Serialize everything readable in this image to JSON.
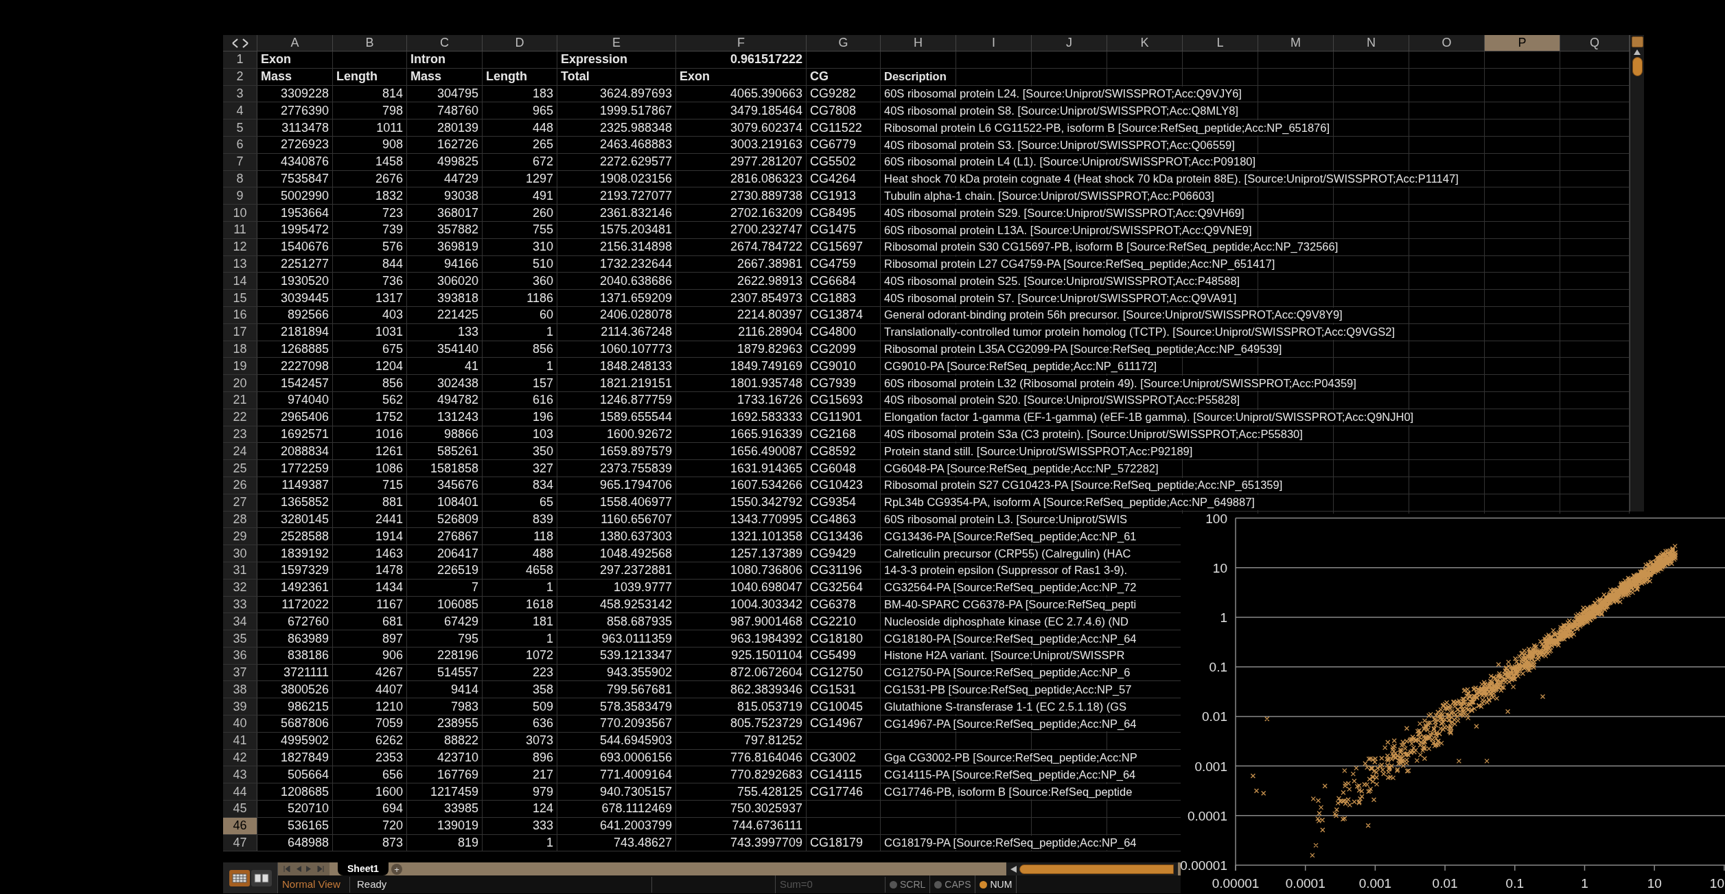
{
  "columns": [
    {
      "label": "A",
      "selected": false
    },
    {
      "label": "B",
      "selected": false
    },
    {
      "label": "C",
      "selected": false
    },
    {
      "label": "D",
      "selected": false
    },
    {
      "label": "E",
      "selected": false
    },
    {
      "label": "F",
      "selected": false
    },
    {
      "label": "G",
      "selected": false
    },
    {
      "label": "H",
      "selected": false
    },
    {
      "label": "I",
      "selected": false
    },
    {
      "label": "J",
      "selected": false
    },
    {
      "label": "K",
      "selected": false
    },
    {
      "label": "L",
      "selected": false
    },
    {
      "label": "M",
      "selected": false
    },
    {
      "label": "N",
      "selected": false
    },
    {
      "label": "O",
      "selected": false
    },
    {
      "label": "P",
      "selected": true
    },
    {
      "label": "Q",
      "selected": false
    }
  ],
  "rows": [
    {
      "number": "1",
      "selected": false,
      "kind": "header",
      "cells": [
        {
          "text": "Exon",
          "kind": "label"
        },
        null,
        {
          "text": "Intron",
          "kind": "label"
        },
        null,
        {
          "text": "Expression",
          "kind": "label"
        },
        {
          "text": "0.961517222",
          "kind": "number"
        },
        null
      ]
    },
    {
      "number": "2",
      "selected": false,
      "kind": "header",
      "cells": [
        {
          "text": "Mass",
          "kind": "label"
        },
        {
          "text": "Length",
          "kind": "label"
        },
        {
          "text": "Mass",
          "kind": "label"
        },
        {
          "text": "Length",
          "kind": "label"
        },
        {
          "text": "Total",
          "kind": "label"
        },
        {
          "text": "Exon",
          "kind": "label"
        },
        {
          "text": "CG",
          "kind": "label"
        }
      ],
      "description": "Description"
    },
    {
      "number": "3",
      "selected": false,
      "kind": "data",
      "cells": [
        "3309228",
        "814",
        "304795",
        "183",
        "3624.897693",
        "4065.390663",
        "CG9282"
      ],
      "description": "60S ribosomal protein L24. [Source:Uniprot/SWISSPROT;Acc:Q9VJY6]"
    },
    {
      "number": "4",
      "selected": false,
      "kind": "data",
      "cells": [
        "2776390",
        "798",
        "748760",
        "965",
        "1999.517867",
        "3479.185464",
        "CG7808"
      ],
      "description": "40S ribosomal protein S8. [Source:Uniprot/SWISSPROT;Acc:Q8MLY8]"
    },
    {
      "number": "5",
      "selected": false,
      "kind": "data",
      "cells": [
        "3113478",
        "1011",
        "280139",
        "448",
        "2325.988348",
        "3079.602374",
        "CG11522"
      ],
      "description": "Ribosomal protein L6 CG11522-PB, isoform B [Source:RefSeq_peptide;Acc:NP_651876]"
    },
    {
      "number": "6",
      "selected": false,
      "kind": "data",
      "cells": [
        "2726923",
        "908",
        "162726",
        "265",
        "2463.468883",
        "3003.219163",
        "CG6779"
      ],
      "description": "40S ribosomal protein S3. [Source:Uniprot/SWISSPROT;Acc:Q06559]"
    },
    {
      "number": "7",
      "selected": false,
      "kind": "data",
      "cells": [
        "4340876",
        "1458",
        "499825",
        "672",
        "2272.629577",
        "2977.281207",
        "CG5502"
      ],
      "description": "60S ribosomal protein L4 (L1). [Source:Uniprot/SWISSPROT;Acc:P09180]"
    },
    {
      "number": "8",
      "selected": false,
      "kind": "data",
      "cells": [
        "7535847",
        "2676",
        "44729",
        "1297",
        "1908.023156",
        "2816.086323",
        "CG4264"
      ],
      "description": "Heat shock 70 kDa protein cognate 4 (Heat shock 70 kDa protein 88E). [Source:Uniprot/SWISSPROT;Acc:P11147]"
    },
    {
      "number": "9",
      "selected": false,
      "kind": "data",
      "cells": [
        "5002990",
        "1832",
        "93038",
        "491",
        "2193.727077",
        "2730.889738",
        "CG1913"
      ],
      "description": "Tubulin alpha-1 chain. [Source:Uniprot/SWISSPROT;Acc:P06603]"
    },
    {
      "number": "10",
      "selected": false,
      "kind": "data",
      "cells": [
        "1953664",
        "723",
        "368017",
        "260",
        "2361.832146",
        "2702.163209",
        "CG8495"
      ],
      "description": "40S ribosomal protein S29. [Source:Uniprot/SWISSPROT;Acc:Q9VH69]"
    },
    {
      "number": "11",
      "selected": false,
      "kind": "data",
      "cells": [
        "1995472",
        "739",
        "357882",
        "755",
        "1575.203481",
        "2700.232747",
        "CG1475"
      ],
      "description": "60S ribosomal protein L13A. [Source:Uniprot/SWISSPROT;Acc:Q9VNE9]"
    },
    {
      "number": "12",
      "selected": false,
      "kind": "data",
      "cells": [
        "1540676",
        "576",
        "369819",
        "310",
        "2156.314898",
        "2674.784722",
        "CG15697"
      ],
      "description": "Ribosomal protein S30 CG15697-PB, isoform B [Source:RefSeq_peptide;Acc:NP_732566]"
    },
    {
      "number": "13",
      "selected": false,
      "kind": "data",
      "cells": [
        "2251277",
        "844",
        "94166",
        "510",
        "1732.232644",
        "2667.38981",
        "CG4759"
      ],
      "description": "Ribosomal protein L27 CG4759-PA [Source:RefSeq_peptide;Acc:NP_651417]"
    },
    {
      "number": "14",
      "selected": false,
      "kind": "data",
      "cells": [
        "1930520",
        "736",
        "306020",
        "360",
        "2040.638686",
        "2622.98913",
        "CG6684"
      ],
      "description": "40S ribosomal protein S25. [Source:Uniprot/SWISSPROT;Acc:P48588]"
    },
    {
      "number": "15",
      "selected": false,
      "kind": "data",
      "cells": [
        "3039445",
        "1317",
        "393818",
        "1186",
        "1371.659209",
        "2307.854973",
        "CG1883"
      ],
      "description": "40S ribosomal protein S7. [Source:Uniprot/SWISSPROT;Acc:Q9VA91]"
    },
    {
      "number": "16",
      "selected": false,
      "kind": "data",
      "cells": [
        "892566",
        "403",
        "221425",
        "60",
        "2406.028078",
        "2214.80397",
        "CG13874"
      ],
      "description": "General odorant-binding protein 56h precursor. [Source:Uniprot/SWISSPROT;Acc:Q9V8Y9]"
    },
    {
      "number": "17",
      "selected": false,
      "kind": "data",
      "cells": [
        "2181894",
        "1031",
        "133",
        "1",
        "2114.367248",
        "2116.28904",
        "CG4800"
      ],
      "description": "Translationally-controlled tumor protein homolog (TCTP). [Source:Uniprot/SWISSPROT;Acc:Q9VGS2]"
    },
    {
      "number": "18",
      "selected": false,
      "kind": "data",
      "cells": [
        "1268885",
        "675",
        "354140",
        "856",
        "1060.107773",
        "1879.82963",
        "CG2099"
      ],
      "description": "Ribosomal protein L35A CG2099-PA [Source:RefSeq_peptide;Acc:NP_649539]"
    },
    {
      "number": "19",
      "selected": false,
      "kind": "data",
      "cells": [
        "2227098",
        "1204",
        "41",
        "1",
        "1848.248133",
        "1849.749169",
        "CG9010"
      ],
      "description": "CG9010-PA [Source:RefSeq_peptide;Acc:NP_611172]"
    },
    {
      "number": "20",
      "selected": false,
      "kind": "data",
      "cells": [
        "1542457",
        "856",
        "302438",
        "157",
        "1821.219151",
        "1801.935748",
        "CG7939"
      ],
      "description": "60S ribosomal protein L32 (Ribosomal protein 49). [Source:Uniprot/SWISSPROT;Acc:P04359]"
    },
    {
      "number": "21",
      "selected": false,
      "kind": "data",
      "cells": [
        "974040",
        "562",
        "494782",
        "616",
        "1246.877759",
        "1733.16726",
        "CG15693"
      ],
      "description": "40S ribosomal protein S20. [Source:Uniprot/SWISSPROT;Acc:P55828]"
    },
    {
      "number": "22",
      "selected": false,
      "kind": "data",
      "cells": [
        "2965406",
        "1752",
        "131243",
        "196",
        "1589.655544",
        "1692.583333",
        "CG11901"
      ],
      "description": "Elongation factor 1-gamma (EF-1-gamma) (eEF-1B gamma). [Source:Uniprot/SWISSPROT;Acc:Q9NJH0]"
    },
    {
      "number": "23",
      "selected": false,
      "kind": "data",
      "cells": [
        "1692571",
        "1016",
        "98866",
        "103",
        "1600.92672",
        "1665.916339",
        "CG2168"
      ],
      "description": "40S ribosomal protein S3a (C3 protein). [Source:Uniprot/SWISSPROT;Acc:P55830]"
    },
    {
      "number": "24",
      "selected": false,
      "kind": "data",
      "cells": [
        "2088834",
        "1261",
        "585261",
        "350",
        "1659.897579",
        "1656.490087",
        "CG8592"
      ],
      "description": "Protein stand still. [Source:Uniprot/SWISSPROT;Acc:P92189]"
    },
    {
      "number": "25",
      "selected": false,
      "kind": "data",
      "cells": [
        "1772259",
        "1086",
        "1581858",
        "327",
        "2373.755839",
        "1631.914365",
        "CG6048"
      ],
      "description": "CG6048-PA [Source:RefSeq_peptide;Acc:NP_572282]"
    },
    {
      "number": "26",
      "selected": false,
      "kind": "data",
      "cells": [
        "1149387",
        "715",
        "345676",
        "834",
        "965.1794706",
        "1607.534266",
        "CG10423"
      ],
      "description": "Ribosomal protein S27 CG10423-PA [Source:RefSeq_peptide;Acc:NP_651359]"
    },
    {
      "number": "27",
      "selected": false,
      "kind": "data",
      "cells": [
        "1365852",
        "881",
        "108401",
        "65",
        "1558.406977",
        "1550.342792",
        "CG9354"
      ],
      "description": "RpL34b CG9354-PA, isoform A [Source:RefSeq_peptide;Acc:NP_649887]"
    },
    {
      "number": "28",
      "selected": false,
      "kind": "data",
      "cells": [
        "3280145",
        "2441",
        "526809",
        "839",
        "1160.656707",
        "1343.770995",
        "CG4863"
      ],
      "description": "60S ribosomal protein L3. [Source:Uniprot/SWIS"
    },
    {
      "number": "29",
      "selected": false,
      "kind": "data",
      "cells": [
        "2528588",
        "1914",
        "276867",
        "118",
        "1380.637303",
        "1321.101358",
        "CG13436"
      ],
      "description": "CG13436-PA [Source:RefSeq_peptide;Acc:NP_61"
    },
    {
      "number": "30",
      "selected": false,
      "kind": "data",
      "cells": [
        "1839192",
        "1463",
        "206417",
        "488",
        "1048.492568",
        "1257.137389",
        "CG9429"
      ],
      "description": "Calreticulin precursor (CRP55) (Calregulin) (HAC"
    },
    {
      "number": "31",
      "selected": false,
      "kind": "data",
      "cells": [
        "1597329",
        "1478",
        "226519",
        "4658",
        "297.2372881",
        "1080.736806",
        "CG31196"
      ],
      "description": "14-3-3 protein epsilon (Suppressor of Ras1 3-9)."
    },
    {
      "number": "32",
      "selected": false,
      "kind": "data",
      "cells": [
        "1492361",
        "1434",
        "7",
        "1",
        "1039.9777",
        "1040.698047",
        "CG32564"
      ],
      "description": "CG32564-PA [Source:RefSeq_peptide;Acc:NP_72"
    },
    {
      "number": "33",
      "selected": false,
      "kind": "data",
      "cells": [
        "1172022",
        "1167",
        "106085",
        "1618",
        "458.9253142",
        "1004.303342",
        "CG6378"
      ],
      "description": "BM-40-SPARC CG6378-PA [Source:RefSeq_pepti"
    },
    {
      "number": "34",
      "selected": false,
      "kind": "data",
      "cells": [
        "672760",
        "681",
        "67429",
        "181",
        "858.687935",
        "987.9001468",
        "CG2210"
      ],
      "description": "Nucleoside diphosphate kinase (EC 2.7.4.6) (ND"
    },
    {
      "number": "35",
      "selected": false,
      "kind": "data",
      "cells": [
        "863989",
        "897",
        "795",
        "1",
        "963.0111359",
        "963.1984392",
        "CG18180"
      ],
      "description": "CG18180-PA [Source:RefSeq_peptide;Acc:NP_64"
    },
    {
      "number": "36",
      "selected": false,
      "kind": "data",
      "cells": [
        "838186",
        "906",
        "228196",
        "1072",
        "539.1213347",
        "925.1501104",
        "CG5499"
      ],
      "description": "Histone H2A variant. [Source:Uniprot/SWISSPR"
    },
    {
      "number": "37",
      "selected": false,
      "kind": "data",
      "cells": [
        "3721111",
        "4267",
        "514557",
        "223",
        "943.355902",
        "872.0672604",
        "CG12750"
      ],
      "description": "CG12750-PA [Source:RefSeq_peptide;Acc:NP_6"
    },
    {
      "number": "38",
      "selected": false,
      "kind": "data",
      "cells": [
        "3800526",
        "4407",
        "9414",
        "358",
        "799.567681",
        "862.3839346",
        "CG1531"
      ],
      "description": "CG1531-PB [Source:RefSeq_peptide;Acc:NP_57"
    },
    {
      "number": "39",
      "selected": false,
      "kind": "data",
      "cells": [
        "986215",
        "1210",
        "7983",
        "509",
        "578.3583479",
        "815.053719",
        "CG10045"
      ],
      "description": "Glutathione S-transferase 1-1 (EC 2.5.1.18) (GS"
    },
    {
      "number": "40",
      "selected": false,
      "kind": "data",
      "cells": [
        "5687806",
        "7059",
        "238955",
        "636",
        "770.2093567",
        "805.7523729",
        "CG14967"
      ],
      "description": "CG14967-PA [Source:RefSeq_peptide;Acc:NP_64"
    },
    {
      "number": "41",
      "selected": false,
      "kind": "data",
      "cells": [
        "4995902",
        "6262",
        "88822",
        "3073",
        "544.6945903",
        "797.81252",
        null
      ]
    },
    {
      "number": "42",
      "selected": false,
      "kind": "data",
      "cells": [
        "1827849",
        "2353",
        "423710",
        "896",
        "693.0006156",
        "776.8164046",
        "CG3002"
      ],
      "description": "Gga CG3002-PB [Source:RefSeq_peptide;Acc:NP"
    },
    {
      "number": "43",
      "selected": false,
      "kind": "data",
      "cells": [
        "505664",
        "656",
        "167769",
        "217",
        "771.4009164",
        "770.8292683",
        "CG14115"
      ],
      "description": "CG14115-PA [Source:RefSeq_peptide;Acc:NP_64"
    },
    {
      "number": "44",
      "selected": false,
      "kind": "data",
      "cells": [
        "1208685",
        "1600",
        "1217459",
        "979",
        "940.7305157",
        "755.428125",
        "CG17746"
      ],
      "description": "CG17746-PB, isoform B [Source:RefSeq_peptide"
    },
    {
      "number": "45",
      "selected": false,
      "kind": "data",
      "cells": [
        "520710",
        "694",
        "33985",
        "124",
        "678.1112469",
        "750.3025937",
        null
      ]
    },
    {
      "number": "46",
      "selected": true,
      "kind": "data",
      "cells": [
        "536165",
        "720",
        "139019",
        "333",
        "641.2003799",
        "744.6736111",
        null
      ]
    },
    {
      "number": "47",
      "selected": false,
      "kind": "data",
      "cells": [
        "648988",
        "873",
        "819",
        "1",
        "743.48627",
        "743.3997709",
        "CG18179"
      ],
      "description": "CG18179-PA [Source:RefSeq_peptide;Acc:NP_64"
    }
  ],
  "views": [
    {
      "kind": "normal",
      "selected": true
    },
    {
      "kind": "page",
      "selected": false
    }
  ],
  "sheet_tabs": [
    {
      "label": "Sheet1",
      "selected": true
    }
  ],
  "add_sheet": "+",
  "status_bar": {
    "view": "Normal View",
    "status": "Ready",
    "sum": "Sum=0",
    "indicators": [
      {
        "label": "SCRL",
        "on": false
      },
      {
        "label": "CAPS",
        "on": false
      },
      {
        "label": "NUM",
        "on": true
      }
    ]
  },
  "chart": {
    "x_axis_labels": [
      "0.00001",
      "0.0001",
      "0.001",
      "0.01",
      "0.1",
      "1",
      "10",
      "10"
    ],
    "y_axis_labels": [
      "100",
      "10",
      "1",
      "0.1",
      "0.01",
      "0.001",
      "0.0001",
      "0.00001"
    ]
  }
}
